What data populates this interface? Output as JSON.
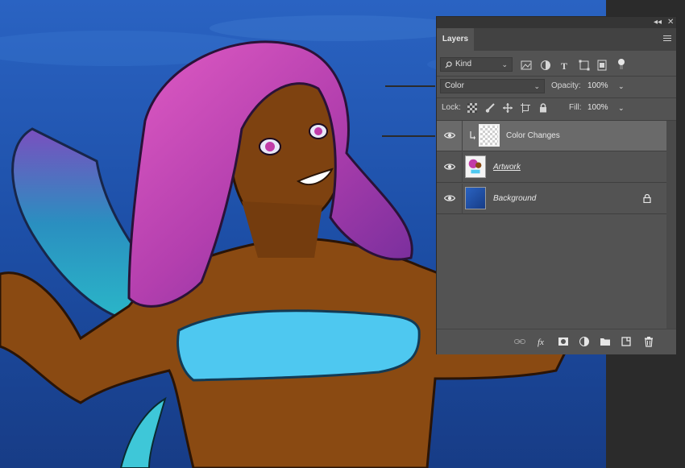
{
  "panel": {
    "tab_label": "Layers",
    "collapse_glyph": "◂◂",
    "close_glyph": "✕",
    "filter": {
      "kind_label": "Kind",
      "search_icon": "search-icon"
    },
    "blend": {
      "mode": "Color",
      "opacity_label": "Opacity:",
      "opacity_value": "100%"
    },
    "lock": {
      "label": "Lock:",
      "fill_label": "Fill:",
      "fill_value": "100%"
    },
    "layers": [
      {
        "name": "Color Changes",
        "selected": true,
        "clipped": true
      },
      {
        "name": "Artwork",
        "selected": false
      },
      {
        "name": "Background",
        "selected": false,
        "locked": true
      }
    ],
    "footer_icons": [
      "link-icon",
      "fx-icon",
      "mask-icon",
      "adjustment-icon",
      "folder-icon",
      "new-layer-icon",
      "trash-icon"
    ]
  },
  "colors": {
    "panel_bg": "#535353",
    "selected_row": "#6a6a6a",
    "ocean": "#1d4a9e",
    "hair_pink": "#c23ca8",
    "hair_teal": "#2aa7c4",
    "skin": "#8a4a12",
    "top": "#4ec8f0"
  }
}
